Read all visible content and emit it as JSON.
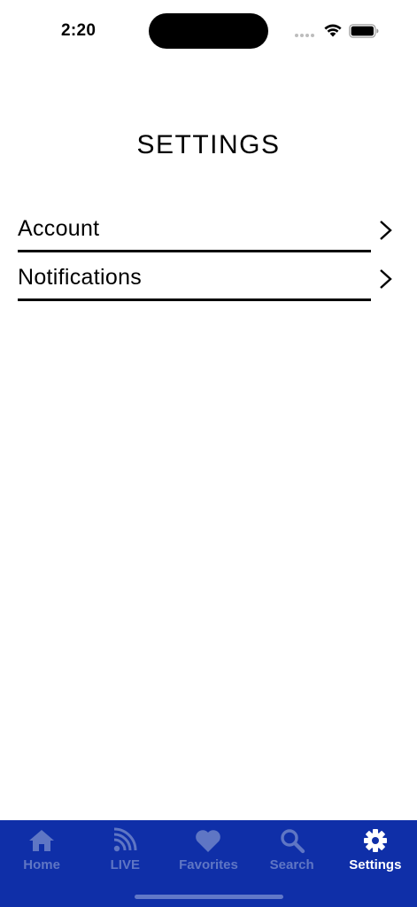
{
  "status_bar": {
    "time": "2:20"
  },
  "page": {
    "title": "SETTINGS"
  },
  "settings_list": {
    "items": [
      {
        "label": "Account",
        "icon": "chevron-right-icon"
      },
      {
        "label": "Notifications",
        "icon": "chevron-right-icon"
      }
    ]
  },
  "tab_bar": {
    "background_color": "#0f2fa8",
    "inactive_color": "#5f76c4",
    "active_color": "#ffffff",
    "tabs": [
      {
        "label": "Home",
        "icon": "home-icon",
        "active": false
      },
      {
        "label": "LIVE",
        "icon": "live-signal-icon",
        "active": false
      },
      {
        "label": "Favorites",
        "icon": "heart-icon",
        "active": false
      },
      {
        "label": "Search",
        "icon": "search-icon",
        "active": false
      },
      {
        "label": "Settings",
        "icon": "gear-icon",
        "active": true
      }
    ]
  }
}
